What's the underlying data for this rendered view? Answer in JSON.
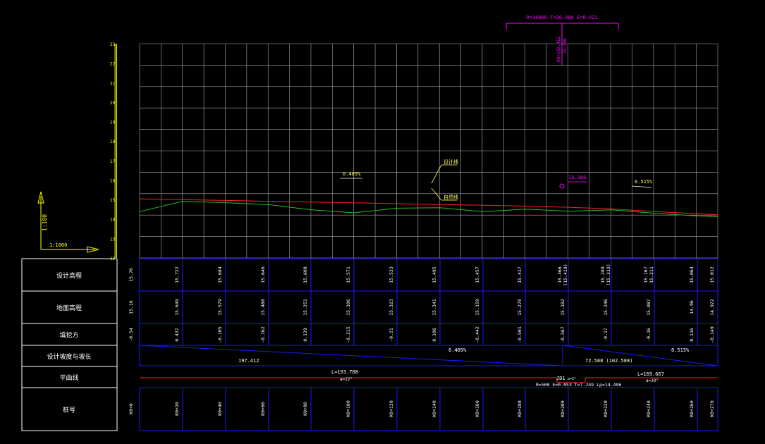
{
  "colors": {
    "grid": "#a8a8a8",
    "axis": "#ffff00",
    "table_blue": "#1a1aff",
    "design_line": "#ff2020",
    "ground_line": "#20c020",
    "magenta": "#ff00ff",
    "label_yellow": "#ffff66"
  },
  "scale": {
    "vertical": "1:100",
    "horizontal": "1:1000"
  },
  "elevation_axis": {
    "ticks": [
      "23",
      "22",
      "21",
      "20",
      "19",
      "18",
      "17",
      "16",
      "15",
      "14",
      "13",
      "12"
    ]
  },
  "vertical_curve": {
    "label": "R=16000 T=26.000 E=0.021",
    "station": "K0+192.412",
    "elevation": "15.386"
  },
  "annotations": {
    "design_line_label": "设计线",
    "ground_line_label": "自然线",
    "grade_left": "0.489%",
    "grade_right": "0.515%",
    "pvi_elev": "15.386"
  },
  "row_headers": [
    "设计高程",
    "地面高程",
    "填挖方",
    "设计坡度与坡长",
    "平曲线",
    "桩号"
  ],
  "columns": [
    {
      "station": "K0+0",
      "design": "15.76",
      "ground": "15.16",
      "cutfill": "-0.54"
    },
    {
      "station": "K0+20",
      "design": "15.722",
      "ground": "15.649",
      "cutfill": "0.437"
    },
    {
      "station": "K0+40",
      "design": "15.684",
      "ground": "15.579",
      "cutfill": "-0.105"
    },
    {
      "station": "K0+60",
      "design": "15.646",
      "ground": "15.488",
      "cutfill": "-0.162"
    },
    {
      "station": "K0+80",
      "design": "15.608",
      "ground": "15.251",
      "cutfill": "0.129"
    },
    {
      "station": "K0+100",
      "design": "15.571",
      "ground": "15.106",
      "cutfill": "-0.215"
    },
    {
      "station": "K0+120",
      "design": "15.533",
      "ground": "15.323",
      "cutfill": "-0.21"
    },
    {
      "station": "K0+140",
      "design": "15.495",
      "ground": "15.341",
      "cutfill": "0.106"
    },
    {
      "station": "K0+160",
      "design": "15.457",
      "ground": "15.159",
      "cutfill": "-0.442"
    },
    {
      "station": "K0+180",
      "design": "15.417",
      "ground": "15.278",
      "cutfill": "-0.501"
    },
    {
      "station": "K0+200",
      "design": "15.366",
      "design_extra": "(15.419)",
      "ground": "15.182",
      "cutfill": "-0.567"
    },
    {
      "station": "K0+220",
      "design": "15.289",
      "design_extra": "(15.313)",
      "ground": "15.246",
      "cutfill": "-0.17"
    },
    {
      "station": "K0+240",
      "design": "15.167",
      "design_extra": "15.211",
      "ground": "15.087",
      "cutfill": "-0.16"
    },
    {
      "station": "K0+260",
      "design": "15.064",
      "ground": "14.96",
      "cutfill": "0.116"
    },
    {
      "station": "K0+270",
      "design": "15.012",
      "ground": "14.922",
      "cutfill": "-0.149"
    }
  ],
  "grade_row": {
    "left_grade": "0.489%",
    "left_length": "197.412",
    "right_grade": "0.515%",
    "right_length": "72.588 (102.588)"
  },
  "curve_row": {
    "left_L": "L=193.788",
    "left_a": "a=22°",
    "jd": "JD1",
    "jd_a": "a=2°",
    "jd_detail": "R=500 E=0.053 T=7.249 Lp=14.496",
    "right_L": "L=169.667",
    "right_a": "a=20°"
  }
}
